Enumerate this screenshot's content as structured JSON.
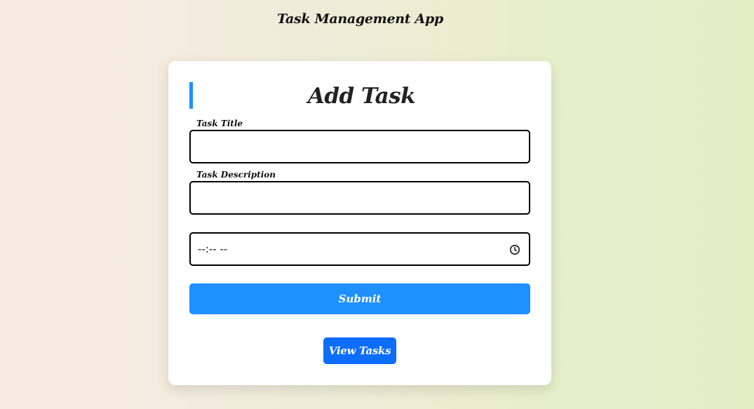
{
  "app": {
    "title": "Task Management App"
  },
  "form": {
    "heading": "Add Task",
    "title_label": "Task Title",
    "title_value": "",
    "description_label": "Task Description",
    "description_value": "",
    "time_placeholder": "--:-- --",
    "submit_label": "Submit"
  },
  "nav": {
    "view_tasks_label": "View Tasks"
  },
  "icons": {
    "time_picker": "clock-icon"
  },
  "colors": {
    "accent": "#1e90ff",
    "view_button": "#0d6efd"
  }
}
